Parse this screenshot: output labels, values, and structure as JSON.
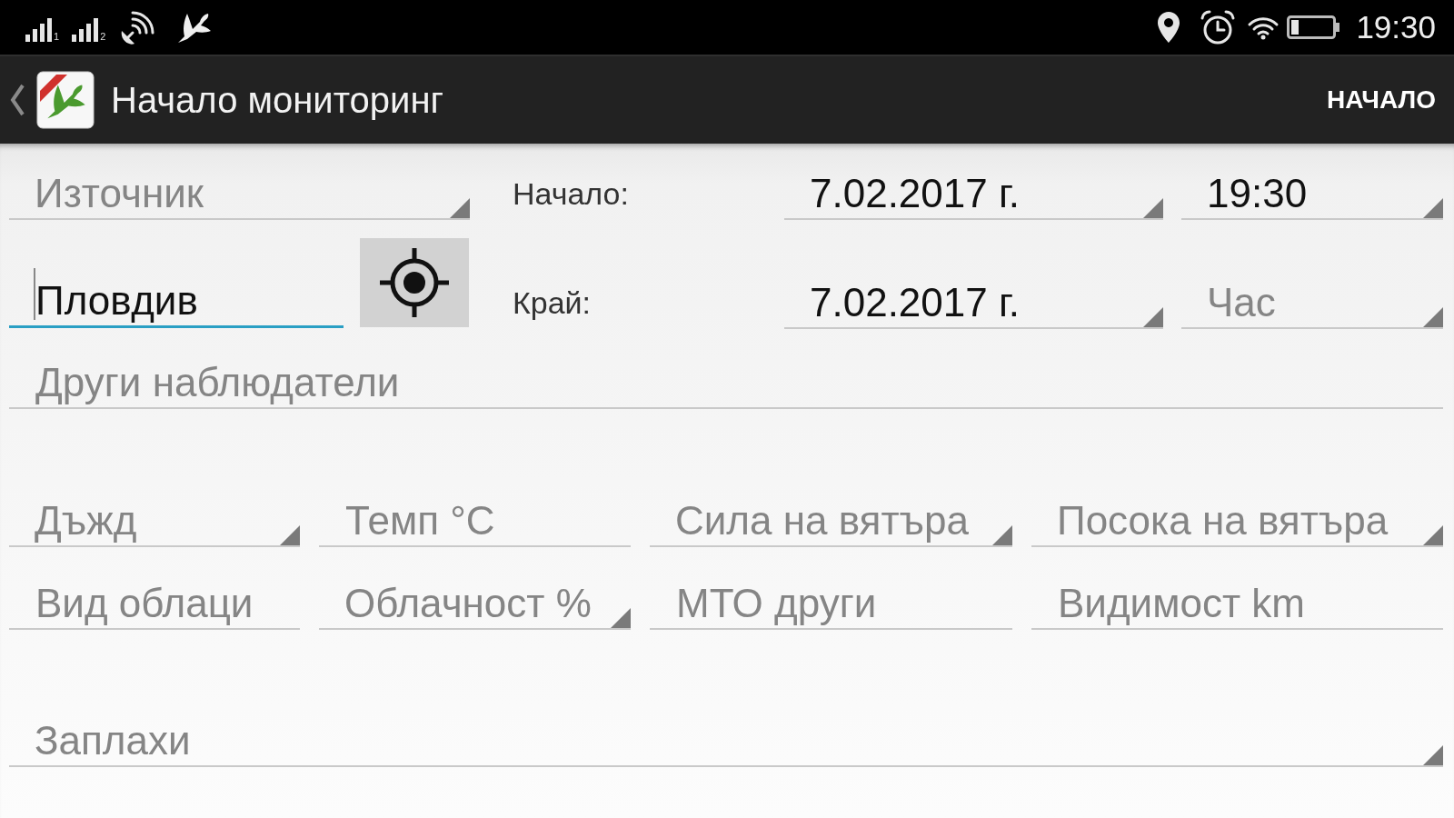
{
  "status_bar": {
    "sims": [
      {
        "label": "1"
      },
      {
        "label": "2"
      }
    ],
    "time": "19:30"
  },
  "app_bar": {
    "title": "Начало мониторинг",
    "action": "НАЧАЛО"
  },
  "form": {
    "source": {
      "kind": "spinner",
      "placeholder": "Източник"
    },
    "start": {
      "label": "Начало:",
      "date": {
        "kind": "spinner",
        "value": "7.02.2017 г."
      },
      "time": {
        "kind": "spinner",
        "value": "19:30"
      }
    },
    "location": {
      "kind": "text",
      "value": "Пловдив",
      "focused": true
    },
    "end": {
      "label": "Край:",
      "date": {
        "kind": "spinner",
        "value": "7.02.2017 г."
      },
      "time": {
        "kind": "spinner",
        "placeholder": "Час"
      }
    },
    "observers": {
      "kind": "text",
      "placeholder": "Други наблюдатели",
      "focused": false
    },
    "weather": [
      {
        "kind": "spinner",
        "placeholder": "Дъжд"
      },
      {
        "kind": "text",
        "placeholder": "Темп °C",
        "focused": false
      },
      {
        "kind": "spinner",
        "placeholder": "Сила на вятъра"
      },
      {
        "kind": "spinner",
        "placeholder": "Посока на вятъра"
      },
      {
        "kind": "text",
        "placeholder": "Вид облаци",
        "focused": false
      },
      {
        "kind": "spinner",
        "placeholder": "Облачност %"
      },
      {
        "kind": "text",
        "placeholder": "МТО други",
        "focused": false
      },
      {
        "kind": "text",
        "placeholder": "Видимост km",
        "focused": false
      }
    ],
    "threats": {
      "kind": "spinner",
      "placeholder": "Заплахи"
    }
  }
}
